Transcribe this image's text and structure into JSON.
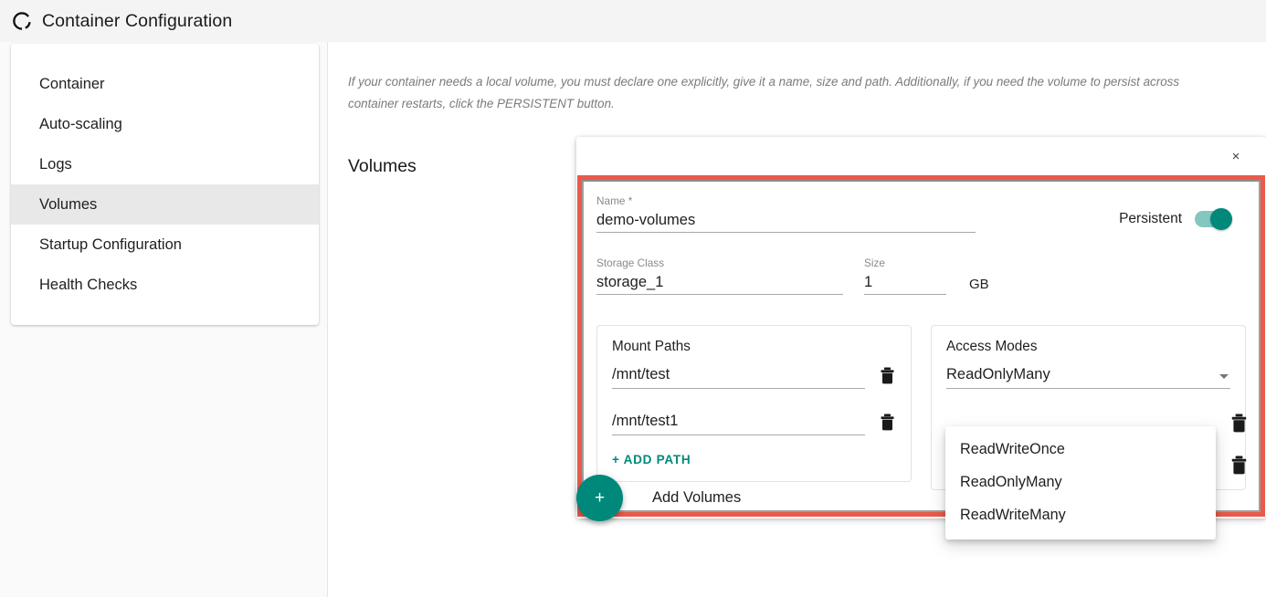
{
  "header": {
    "title": "Container Configuration",
    "logo_icon": "container-ring-icon"
  },
  "sidebar": {
    "items": [
      {
        "label": "Container",
        "active": false
      },
      {
        "label": "Auto-scaling",
        "active": false
      },
      {
        "label": "Logs",
        "active": false
      },
      {
        "label": "Volumes",
        "active": true
      },
      {
        "label": "Startup Configuration",
        "active": false
      },
      {
        "label": "Health Checks",
        "active": false
      }
    ]
  },
  "main": {
    "hint": "If your container needs a local volume, you must declare one explicitly, give it a name, size and path. Additionally, if you need the volume to persist across container restarts, click the PERSISTENT button.",
    "section_title": "Volumes",
    "add_volumes_label": "Add Volumes",
    "add_volumes_icon": "plus-icon"
  },
  "volume_card": {
    "close_icon": "close-icon",
    "close_label": "×",
    "name": {
      "label": "Name *",
      "value": "demo-volumes"
    },
    "persistent": {
      "label": "Persistent",
      "enabled": true
    },
    "storage_class": {
      "label": "Storage Class",
      "value": "storage_1"
    },
    "size": {
      "label": "Size",
      "value": "1",
      "unit": "GB"
    },
    "mount_paths": {
      "title": "Mount Paths",
      "paths": [
        {
          "value": "/mnt/test",
          "delete_icon": "trash-icon"
        },
        {
          "value": "/mnt/test1",
          "delete_icon": "trash-icon"
        }
      ],
      "add_path_label": "+ ADD  PATH"
    },
    "access_modes": {
      "title": "Access Modes",
      "selected": "ReadOnlyMany",
      "caret_icon": "chevron-down-icon",
      "delete_icon": "trash-icon",
      "options": [
        "ReadWriteOnce",
        "ReadOnlyMany",
        "ReadWriteMany"
      ]
    }
  },
  "colors": {
    "accent_teal": "#00897b",
    "toggle_track": "#85c6bf",
    "highlight_red": "#ea5a4a",
    "header_bg": "#f4f4f4",
    "active_nav_bg": "#e8e8e8"
  }
}
